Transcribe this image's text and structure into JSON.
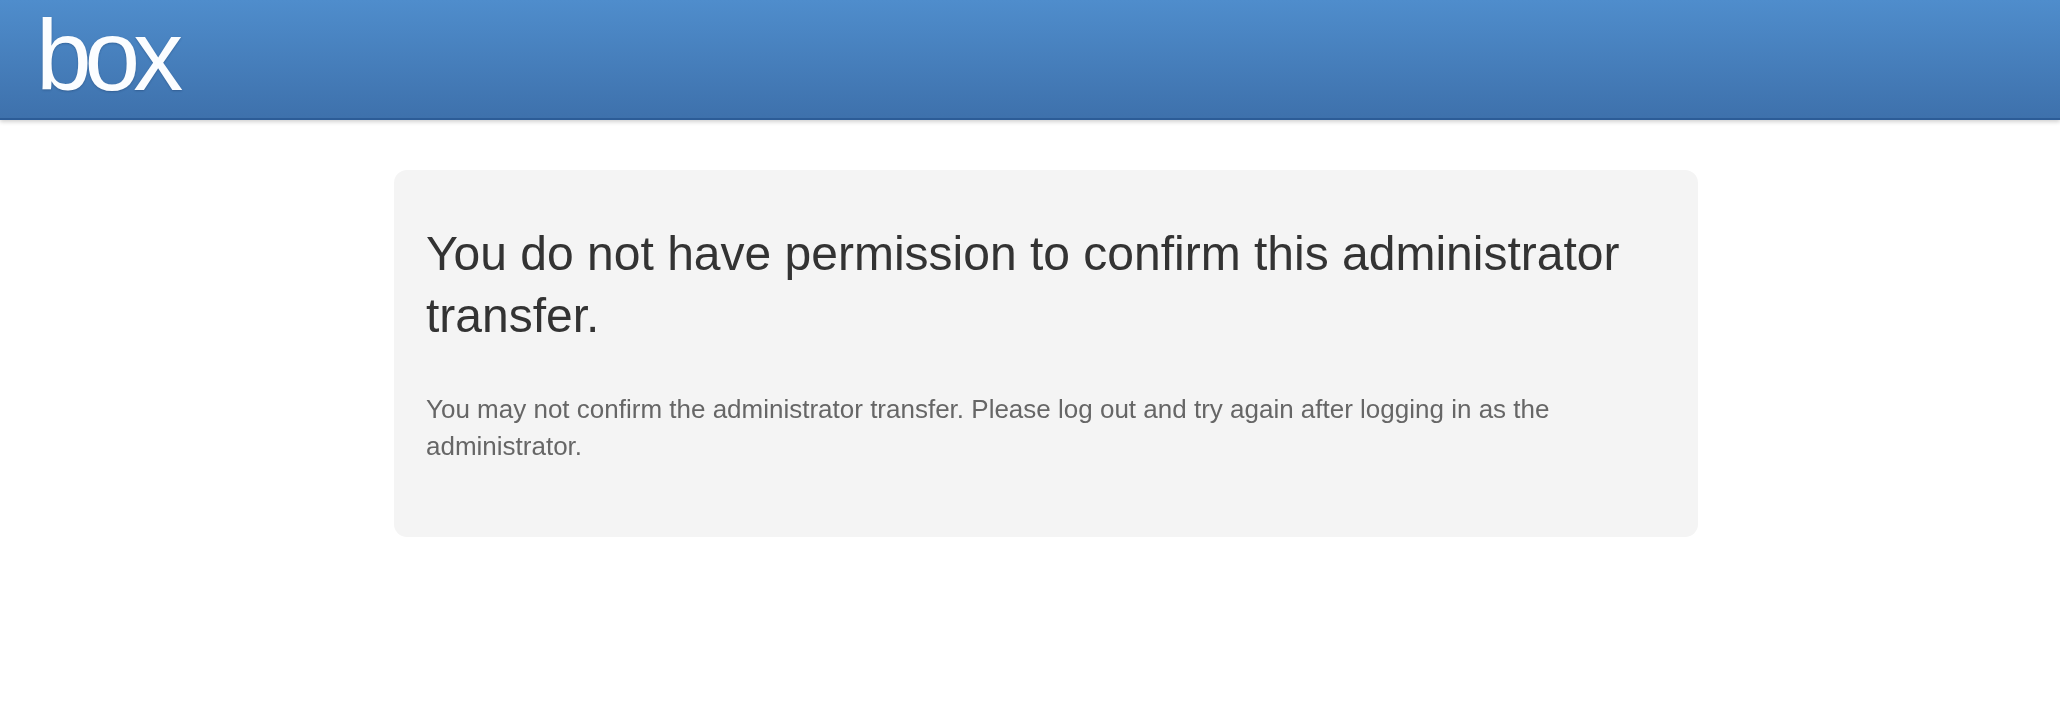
{
  "header": {
    "logo": "box"
  },
  "card": {
    "title": "You do not have permission to confirm this administrator transfer.",
    "message": "You may not confirm the administrator transfer. Please log out and try again after logging in as the administrator."
  }
}
